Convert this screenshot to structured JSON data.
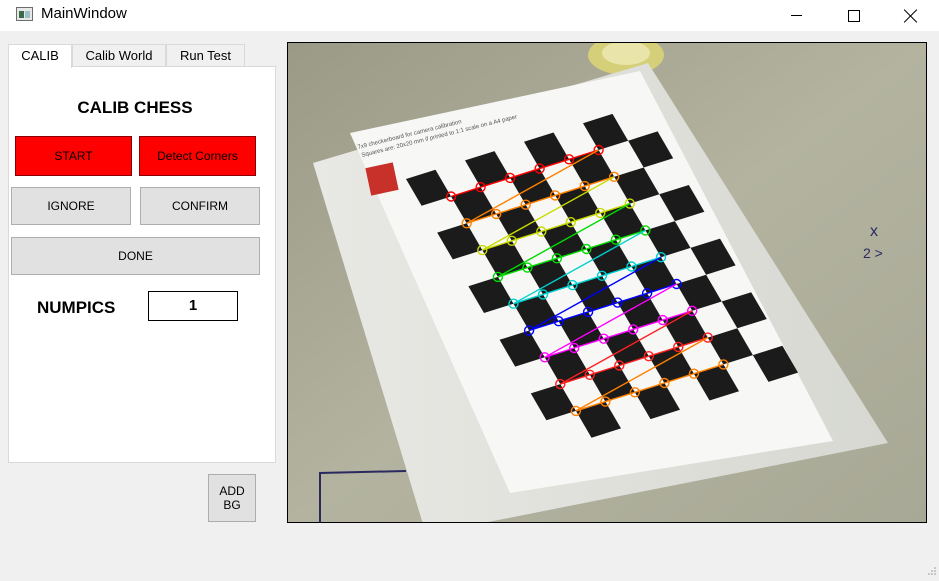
{
  "window": {
    "title": "MainWindow",
    "icon": "qt-window-icon",
    "controls": [
      "minimize-icon",
      "maximize-icon",
      "close-icon"
    ]
  },
  "tabs": [
    {
      "label": "CALIB",
      "active": true
    },
    {
      "label": "Calib World",
      "active": false
    },
    {
      "label": "Run Test",
      "active": false
    }
  ],
  "calib": {
    "heading": "CALIB CHESS",
    "start_label": "START",
    "detect_label": "Detect Corners",
    "ignore_label": "IGNORE",
    "confirm_label": "CONFIRM",
    "done_label": "DONE",
    "numpics_label": "NUMPICS",
    "numpics_value": "1"
  },
  "add_bg_label": "ADD\nBG",
  "camera": {
    "paper_header": "7x9 checkerboard for camera calibration\nSquares are: 20x20 mm if printed to 1:1 scale on a A4 paper",
    "corner_rows": 6,
    "corner_cols": 8
  },
  "colors": {
    "accent_red": "#ff0000",
    "button_gray": "#e1e1e1",
    "panel_white": "#ffffff",
    "corner_line_colors": [
      "#ff0000",
      "#ff8000",
      "#c8dc00",
      "#00dc00",
      "#00d0d0",
      "#0000ff",
      "#ff00ff",
      "#ff2020",
      "#ff8000"
    ]
  }
}
